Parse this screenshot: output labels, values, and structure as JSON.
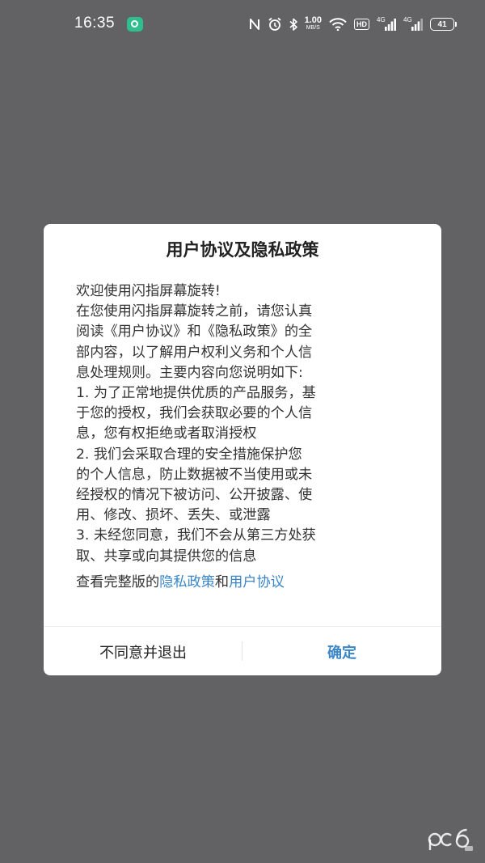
{
  "status_bar": {
    "time": "16:35",
    "net_speed_value": "1.00",
    "net_speed_unit": "MB/S",
    "hd_label": "HD",
    "signal1_label": "4G",
    "signal2_label": "4G",
    "battery_level": "41"
  },
  "dialog": {
    "title": "用户协议及隐私政策",
    "body_lines": [
      "欢迎使用闪指屏幕旋转!",
      "在您使用闪指屏幕旋转之前，请您认真",
      "阅读《用户协议》和《隐私政策》的全",
      "部内容，以了解用户权利义务和个人信",
      "息处理规则。主要内容向您说明如下:",
      "1. 为了正常地提供优质的产品服务，基",
      "于您的授权，我们会获取必要的个人信",
      "息，您有权拒绝或者取消授权",
      "2. 我们会采取合理的安全措施保护您",
      "的个人信息，防止数据被不当使用或未",
      "经授权的情况下被访问、公开披露、使",
      "用、修改、损坏、丢失、或泄露",
      "3. 未经您同意，我们不会从第三方处获",
      "取、共享或向其提供您的信息"
    ],
    "links_prefix": "查看完整版的",
    "privacy_link": "隐私政策",
    "links_and": "和",
    "agreement_link": "用户协议",
    "disagree_button": "不同意并退出",
    "confirm_button": "确定"
  },
  "colors": {
    "overlay": "#626163",
    "link": "#3b86c7",
    "dialog_bg": "#ffffff"
  }
}
